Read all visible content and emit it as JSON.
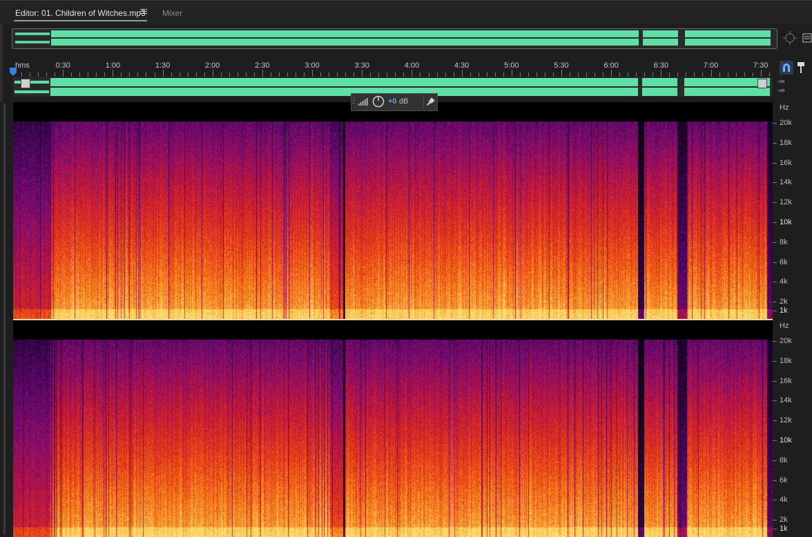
{
  "tabs": {
    "editor_label": "Editor: 01. Children of Witches.mp3",
    "mixer_label": "Mixer"
  },
  "ruler": {
    "units_label": "hms",
    "ticks": [
      {
        "label": "0:30",
        "seconds": 30
      },
      {
        "label": "1:00",
        "seconds": 60
      },
      {
        "label": "1:30",
        "seconds": 90
      },
      {
        "label": "2:00",
        "seconds": 120
      },
      {
        "label": "2:30",
        "seconds": 150
      },
      {
        "label": "3:00",
        "seconds": 180
      },
      {
        "label": "3:30",
        "seconds": 210
      },
      {
        "label": "4:00",
        "seconds": 240
      },
      {
        "label": "4:30",
        "seconds": 270
      },
      {
        "label": "5:00",
        "seconds": 300
      },
      {
        "label": "5:30",
        "seconds": 330
      },
      {
        "label": "6:00",
        "seconds": 360
      },
      {
        "label": "6:30",
        "seconds": 390
      },
      {
        "label": "7:00",
        "seconds": 420
      },
      {
        "label": "7:30",
        "seconds": 450
      }
    ]
  },
  "hud": {
    "value": "+0",
    "unit": "dB"
  },
  "lane": {
    "db_left": "-∞",
    "db_right": "-∞"
  },
  "spectrogram": {
    "axis_unit": "Hz",
    "labels": [
      {
        "text": "20k",
        "hz": 20000,
        "bright": false
      },
      {
        "text": "18k",
        "hz": 18000,
        "bright": false
      },
      {
        "text": "16k",
        "hz": 16000,
        "bright": false
      },
      {
        "text": "14k",
        "hz": 14000,
        "bright": false
      },
      {
        "text": "12k",
        "hz": 12000,
        "bright": false
      },
      {
        "text": "10k",
        "hz": 10000,
        "bright": true
      },
      {
        "text": "8k",
        "hz": 8000,
        "bright": false
      },
      {
        "text": "6k",
        "hz": 6000,
        "bright": false
      },
      {
        "text": "4k",
        "hz": 4000,
        "bright": false
      },
      {
        "text": "2k",
        "hz": 2000,
        "bright": false
      },
      {
        "text": "1k",
        "hz": 1000,
        "bright": true
      }
    ]
  },
  "colors": {
    "waveform": "#5ee0a4",
    "accent": "#4aa3ff"
  },
  "icons": {
    "menu": "hamburger-icon",
    "zoom_target": "crosshair-icon",
    "snap": "magnet-icon",
    "marker": "pin-icon",
    "hud_knob": "knob-icon",
    "hud_meter": "meter-icon",
    "hud_pin": "pushpin-icon"
  }
}
